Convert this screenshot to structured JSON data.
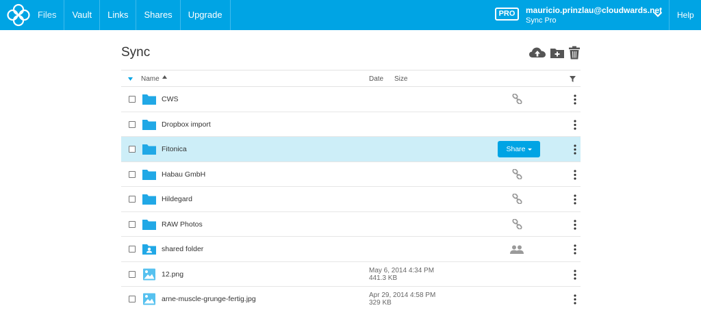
{
  "nav": {
    "items": [
      {
        "label": "Files",
        "active": true
      },
      {
        "label": "Vault"
      },
      {
        "label": "Links"
      },
      {
        "label": "Shares"
      },
      {
        "label": "Upgrade"
      }
    ],
    "help_label": "Help"
  },
  "account": {
    "badge": "PRO",
    "email": "mauricio.prinzlau@cloudwards.net",
    "plan": "Sync Pro"
  },
  "page": {
    "title": "Sync"
  },
  "table": {
    "columns": {
      "name": "Name",
      "date": "Date",
      "size": "Size"
    },
    "rows": [
      {
        "type": "folder",
        "name": "CWS",
        "link": true
      },
      {
        "type": "folder",
        "name": "Dropbox import"
      },
      {
        "type": "folder",
        "name": "Fitonica",
        "selected": true,
        "share_label": "Share"
      },
      {
        "type": "folder",
        "name": "Habau GmbH",
        "link": true
      },
      {
        "type": "folder",
        "name": "Hildegard",
        "link": true
      },
      {
        "type": "folder",
        "name": "RAW Photos",
        "link": true
      },
      {
        "type": "shared-folder",
        "name": "shared folder",
        "shared_users": true
      },
      {
        "type": "image",
        "name": "12.png",
        "date": "May 6, 2014 4:34 PM",
        "size": "441.3 KB"
      },
      {
        "type": "image",
        "name": "arne-muscle-grunge-fertig.jpg",
        "date": "Apr 29, 2014 4:58 PM",
        "size": "329 KB"
      }
    ]
  },
  "colors": {
    "brand": "#00a4e4",
    "folder": "#21a8e6",
    "selected_row": "#cdeef8"
  },
  "icons": {
    "logo": "sync-logo-icon",
    "upload": "cloud-upload-icon",
    "new_folder": "new-folder-icon",
    "trash": "trash-icon",
    "filter": "filter-icon",
    "link": "link-icon",
    "users": "users-icon",
    "kebab": "kebab-menu-icon"
  }
}
